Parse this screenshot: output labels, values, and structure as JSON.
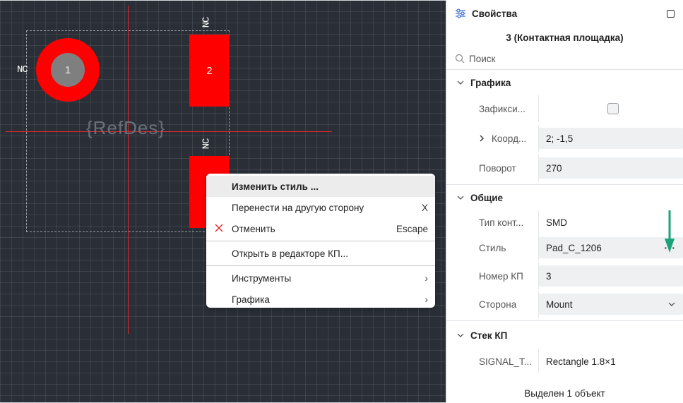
{
  "canvas": {
    "ref_des": "{RefDes}",
    "nc_label": "NC",
    "pads": [
      {
        "number": "1",
        "shape": "round"
      },
      {
        "number": "2",
        "shape": "rect"
      },
      {
        "number": "3",
        "shape": "rect"
      }
    ],
    "colors": {
      "pad": "#ff0000",
      "crosshair": "#e0262a",
      "background": "#2a2f37"
    }
  },
  "context_menu": {
    "items": [
      {
        "label": "Изменить стиль ...",
        "shortcut": "",
        "highlighted": true
      },
      {
        "label": "Перенести на другую сторону",
        "shortcut": "X"
      },
      {
        "label": "Отменить",
        "shortcut": "Escape",
        "icon": "close-icon"
      },
      {
        "label": "Открыть в редакторе КП...",
        "shortcut": ""
      },
      {
        "label": "Инструменты",
        "submenu": true
      },
      {
        "label": "Графика",
        "submenu": true
      }
    ]
  },
  "panel": {
    "title": "Свойства",
    "subtitle": "3 (Контактная площадка)",
    "search_placeholder": "Поиск",
    "sections": {
      "graphics": {
        "title": "Графика",
        "rows": {
          "fixed": {
            "label": "Зафикси...",
            "checked": false
          },
          "coords": {
            "label": "Коорд...",
            "value": "2; -1,5"
          },
          "rotation": {
            "label": "Поворот",
            "value": "270"
          }
        }
      },
      "general": {
        "title": "Общие",
        "rows": {
          "pad_type": {
            "label": "Тип конт...",
            "value": "SMD"
          },
          "style": {
            "label": "Стиль",
            "value": "Pad_C_1206",
            "button": "···"
          },
          "pad_number": {
            "label": "Номер КП",
            "value": "3"
          },
          "side": {
            "label": "Сторона",
            "value": "Mount"
          }
        }
      },
      "pad_stack": {
        "title": "Стек КП",
        "rows": {
          "signal": {
            "label": "SIGNAL_T...",
            "value": "Rectangle 1.8×1"
          }
        }
      }
    },
    "status": "Выделен 1 объект",
    "accent_arrow_color": "#1aa37a"
  }
}
